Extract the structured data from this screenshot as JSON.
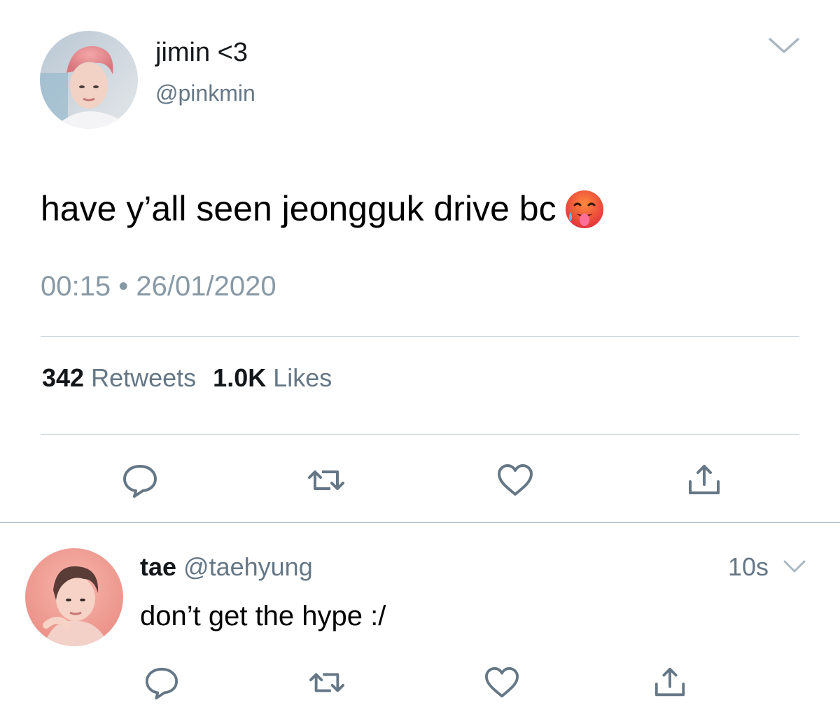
{
  "tweet": {
    "display_name": "jimin <3",
    "handle": "@pinkmin",
    "text": "have y’all seen jeongguk drive bc",
    "emoji": "hot-face-emoji",
    "time": "00:15",
    "separator": "•",
    "date": "26/01/2020",
    "retweet_count": "342",
    "retweet_label": "Retweets",
    "like_count": "1.0K",
    "like_label": "Likes"
  },
  "reply": {
    "display_name": "tae",
    "handle": "@taehyung",
    "text": "don’t get the hype :/",
    "time_ago": "10s"
  },
  "icons": [
    "reply-icon",
    "retweet-icon",
    "like-icon",
    "share-icon",
    "chevron-down-icon"
  ],
  "colors": {
    "icon": "#657786",
    "secondary_text": "#657786",
    "timestamp": "#8899a6",
    "divider": "#ccd6dd",
    "text": "#14171a"
  }
}
